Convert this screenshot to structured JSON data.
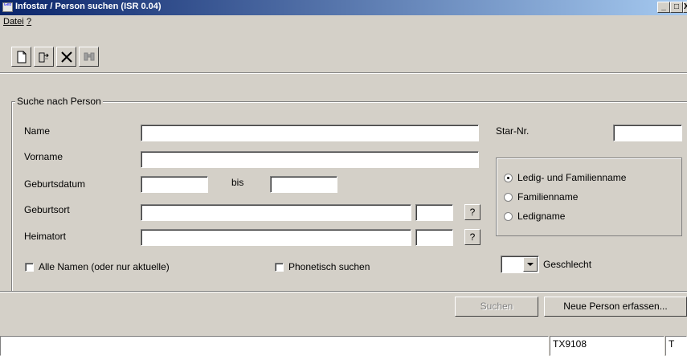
{
  "window": {
    "title": "Infostar / Person suchen  (ISR 0.04)",
    "app_icon_text": "Geb",
    "minimize_glyph": "_",
    "maximize_glyph": "□",
    "close_glyph": "X"
  },
  "menu": {
    "file_label": "Datei",
    "help_label": "?"
  },
  "toolbar": {
    "icons": [
      "new-document-icon",
      "open-folder-icon",
      "delete-icon",
      "binoculars-icon"
    ]
  },
  "search_group": {
    "title": "Suche nach Person",
    "name_label": "Name",
    "name_value": "",
    "firstname_label": "Vorname",
    "firstname_value": "",
    "birthdate_label": "Geburtsdatum",
    "birthdate_from": "",
    "birthdate_to_label": "bis",
    "birthdate_to": "",
    "birthplace_label": "Geburtsort",
    "birthplace_value": "",
    "birthplace_code": "",
    "hometown_label": "Heimatort",
    "hometown_value": "",
    "hometown_code": "",
    "help_button_label": "?",
    "star_nr_label": "Star-Nr.",
    "star_nr_value": "",
    "all_names_label": "Alle Namen (oder nur aktuelle)",
    "all_names_checked": false,
    "phonetic_label": "Phonetisch suchen",
    "phonetic_checked": false,
    "name_type_options": [
      "Ledig- und Familienname",
      "Familienname",
      "Ledigname"
    ],
    "name_type_selected": "Ledig- und Familienname",
    "gender_label": "Geschlecht",
    "gender_value": ""
  },
  "actions": {
    "search_label": "Suchen",
    "search_enabled": false,
    "new_person_label": "Neue Person erfassen..."
  },
  "status": {
    "message": "",
    "code": "TX9108",
    "mode": "T"
  }
}
